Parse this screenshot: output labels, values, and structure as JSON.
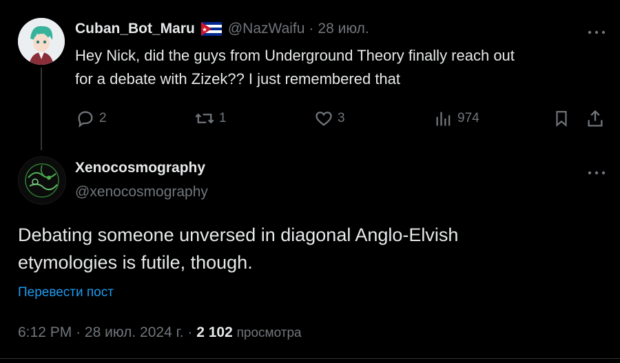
{
  "reply_parent": {
    "display_name": "Cuban_Bot_Maru",
    "handle": "@NazWaifu",
    "separator": "·",
    "date": "28 июл.",
    "text_line1": "Hey Nick, did the guys from Underground Theory finally reach out",
    "text_line2": "for a debate with Zizek?? I just remembered that",
    "actions": {
      "replies": "2",
      "reposts": "1",
      "likes": "3",
      "views": "974"
    },
    "more_icon": "more-horizontal-icon",
    "flag_icon": "cuba-flag-icon"
  },
  "main_tweet": {
    "display_name": "Xenocosmography",
    "handle": "@xenocosmography",
    "text_line1": "Debating someone unversed in diagonal Anglo-Elvish",
    "text_line2": "etymologies is futile, though.",
    "translate_label": "Перевести пост",
    "time": "6:12 PM",
    "sep1": "·",
    "date": "28 июл. 2024 г.",
    "sep2": "·",
    "views_count": "2 102",
    "views_label": "просмотра",
    "more_icon": "more-horizontal-icon"
  },
  "colors": {
    "background": "#000000",
    "text_primary": "#e7e9ea",
    "text_secondary": "#71767b",
    "link": "#1d9bf0",
    "divider": "#2f3336"
  }
}
